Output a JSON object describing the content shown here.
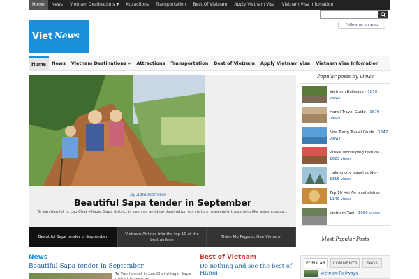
{
  "topnav": [
    "Home",
    "News",
    "Vietnam Destinations",
    "Attractions",
    "Transportation",
    "Best Of Vietnam",
    "Apply Vietnam Visa",
    "Vietnam Visa Infomation"
  ],
  "logo": {
    "part1": "Viet",
    "part2": "News"
  },
  "follow": "Follow us on web",
  "mainnav": [
    "Home",
    "News",
    "Vietnam Destinations »",
    "Attractions",
    "Transportation",
    "Best of Vietnam",
    "Apply Vietnam Visa",
    "Vietnam Visa Infomation"
  ],
  "slider": {
    "byline": "by Administrator",
    "title": "Beautiful Sapa tender in September",
    "excerpt": "Ta Van hamlet in Lao Chai village, Sapa district is seen as an ideal destination for visitors, especially those who like adventurous...",
    "thumbs": [
      "Beautiful Sapa tender in September",
      "Vietnam Airlines into the top 10 of the best airlines",
      "Thien Mu Pagoda, Hue Vietnam"
    ]
  },
  "news": {
    "heading": "News",
    "title": "Beautiful Sapa tender in September",
    "excerpt": "Ta Van hamlet in Lao Chai village, Sapa district is seen as"
  },
  "best": {
    "heading": "Best of Vietnam",
    "title": "Do nothing and see the best of Hanoi"
  },
  "sidebar": {
    "popular_title": "Popular posts by views",
    "posts": [
      {
        "title": "Vietnam Railways",
        "views": "1850 views"
      },
      {
        "title": "Hanoi Travel Guide",
        "views": "1679 views"
      },
      {
        "title": "Nha Trang Travel Guide",
        "views": "1647 views"
      },
      {
        "title": "Whale worshiping festival",
        "views": "1623 views"
      },
      {
        "title": "Halong city travel guide",
        "views": "1315 views"
      },
      {
        "title": "Top 10 Hoi An local dishes",
        "views": "1149 views"
      },
      {
        "title": "Vietnam Taxi",
        "views": "1086 views"
      }
    ],
    "most_popular_title": "Most Popular Posts",
    "tabs": [
      "POPULAR",
      "COMMENTS",
      "TAGS"
    ],
    "first_item": "Vietnam Railways"
  }
}
